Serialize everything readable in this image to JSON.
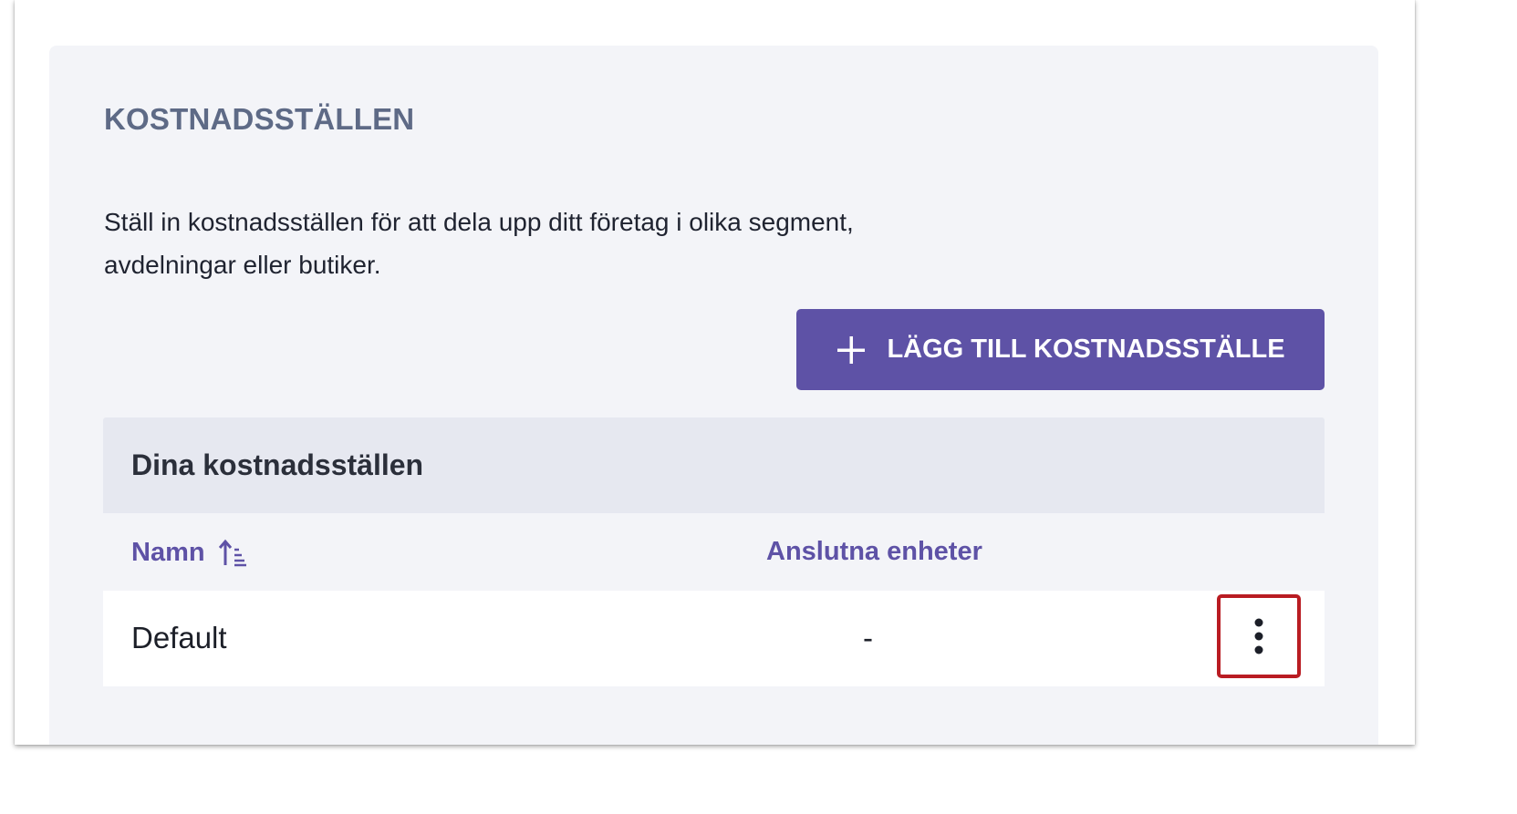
{
  "section": {
    "title": "KOSTNADSSTÄLLEN",
    "description": "Ställ in kostnadsställen för att dela upp ditt företag i olika segment, avdelningar eller butiker."
  },
  "actions": {
    "add_button_label": "LÄGG TILL KOSTNADSSTÄLLE",
    "add_button_icon": "plus-icon"
  },
  "table": {
    "heading": "Dina kostnadsställen",
    "columns": {
      "name": "Namn",
      "connected_units": "Anslutna enheter"
    },
    "sort_icon": "sort-ascending-icon",
    "rows": [
      {
        "name": "Default",
        "connected_units": "-"
      }
    ],
    "row_menu_icon": "more-vertical-icon"
  },
  "colors": {
    "accent": "#5e52a6",
    "title": "#5e6a86",
    "card_background": "#f3f4f8",
    "table_header_background": "#e6e8f0",
    "highlight_border": "#b91c22"
  }
}
